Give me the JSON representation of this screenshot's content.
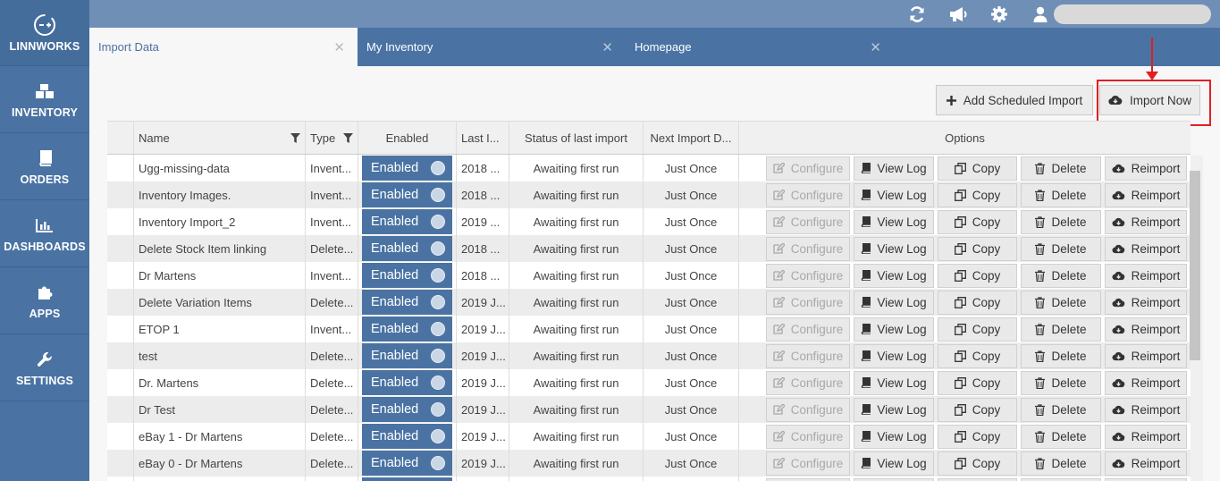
{
  "sidebar": {
    "logo": "LINNWORKS",
    "items": [
      {
        "label": "INVENTORY",
        "icon": "cubes-icon"
      },
      {
        "label": "ORDERS",
        "icon": "book-icon"
      },
      {
        "label": "DASHBOARDS",
        "icon": "bar-chart-icon"
      },
      {
        "label": "APPS",
        "icon": "puzzle-icon"
      },
      {
        "label": "SETTINGS",
        "icon": "wrench-icon"
      }
    ]
  },
  "topbar": {
    "icons": [
      "refresh-icon",
      "megaphone-icon",
      "gear-icon",
      "user-icon"
    ]
  },
  "tabs": [
    {
      "label": "Import Data",
      "active": true
    },
    {
      "label": "My Inventory",
      "active": false
    },
    {
      "label": "Homepage",
      "active": false
    }
  ],
  "toolbar": {
    "add_scheduled_label": "Add Scheduled Import",
    "import_now_label": "Import Now"
  },
  "table": {
    "headers": {
      "name": "Name",
      "type": "Type",
      "enabled": "Enabled",
      "last": "Last I...",
      "status": "Status of last import",
      "next": "Next Import D...",
      "options": "Options"
    },
    "option_labels": {
      "configure": "Configure",
      "view_log": "View Log",
      "copy": "Copy",
      "delete": "Delete",
      "reimport": "Reimport"
    },
    "rows": [
      {
        "name": "Ugg-missing-data",
        "type": "Invent...",
        "enabled": "Enabled",
        "last": "2018 ...",
        "status": "Awaiting first run",
        "next": "Just Once"
      },
      {
        "name": "Inventory Images.",
        "type": "Invent...",
        "enabled": "Enabled",
        "last": "2018 ...",
        "status": "Awaiting first run",
        "next": "Just Once"
      },
      {
        "name": "Inventory Import_2",
        "type": "Invent...",
        "enabled": "Enabled",
        "last": "2019 ...",
        "status": "Awaiting first run",
        "next": "Just Once"
      },
      {
        "name": "Delete Stock Item linking",
        "type": "Delete...",
        "enabled": "Enabled",
        "last": "2018 ...",
        "status": "Awaiting first run",
        "next": "Just Once"
      },
      {
        "name": "Dr Martens",
        "type": "Invent...",
        "enabled": "Enabled",
        "last": "2018 ...",
        "status": "Awaiting first run",
        "next": "Just Once"
      },
      {
        "name": "Delete Variation Items",
        "type": "Delete...",
        "enabled": "Enabled",
        "last": "2019 J...",
        "status": "Awaiting first run",
        "next": "Just Once"
      },
      {
        "name": "ETOP 1",
        "type": "Invent...",
        "enabled": "Enabled",
        "last": "2019 J...",
        "status": "Awaiting first run",
        "next": "Just Once"
      },
      {
        "name": "test",
        "type": "Delete...",
        "enabled": "Enabled",
        "last": "2019 J...",
        "status": "Awaiting first run",
        "next": "Just Once"
      },
      {
        "name": "Dr. Martens",
        "type": "Delete...",
        "enabled": "Enabled",
        "last": "2019 J...",
        "status": "Awaiting first run",
        "next": "Just Once"
      },
      {
        "name": "Dr Test",
        "type": "Delete...",
        "enabled": "Enabled",
        "last": "2019 J...",
        "status": "Awaiting first run",
        "next": "Just Once"
      },
      {
        "name": "eBay 1 - Dr Martens",
        "type": "Delete...",
        "enabled": "Enabled",
        "last": "2019 J...",
        "status": "Awaiting first run",
        "next": "Just Once"
      },
      {
        "name": "eBay 0 - Dr Martens",
        "type": "Delete...",
        "enabled": "Enabled",
        "last": "2019 J...",
        "status": "Awaiting first run",
        "next": "Just Once"
      },
      {
        "name": "",
        "type": "",
        "enabled": "",
        "last": "",
        "status": "",
        "next": ""
      }
    ]
  },
  "colors": {
    "primary": "#4a73a3",
    "highlight": "#e02020"
  }
}
